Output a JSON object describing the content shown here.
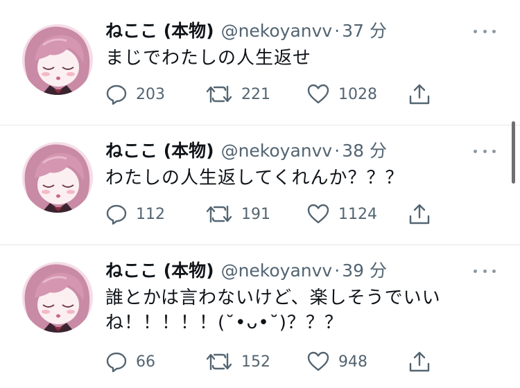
{
  "tweets": [
    {
      "name": "ねここ (本物)",
      "handle": "@nekoyanvv",
      "separator": "·",
      "time": "37 分",
      "text": "まじでわたしの人生返せ",
      "replies": "203",
      "retweets": "221",
      "likes": "1028"
    },
    {
      "name": "ねここ (本物)",
      "handle": "@nekoyanvv",
      "separator": "·",
      "time": "38 分",
      "text": "わたしの人生返してくれんか？？？",
      "replies": "112",
      "retweets": "191",
      "likes": "1124"
    },
    {
      "name": "ねここ (本物)",
      "handle": "@nekoyanvv",
      "separator": "·",
      "time": "39 分",
      "text": "誰とかは言わないけど、楽しそうでいいね！！！！！(˘•ᴗ•˘)？？？",
      "replies": "66",
      "retweets": "152",
      "likes": "948"
    }
  ],
  "icons": {
    "reply": "speech-bubble",
    "retweet": "retweet-arrows",
    "like": "heart",
    "share": "upload-arrow",
    "more": "three-dots"
  },
  "colors": {
    "text": "#0f1419",
    "secondary": "#536471",
    "divider": "#e1e6ea",
    "avatar_hair": "#c88aa4"
  }
}
